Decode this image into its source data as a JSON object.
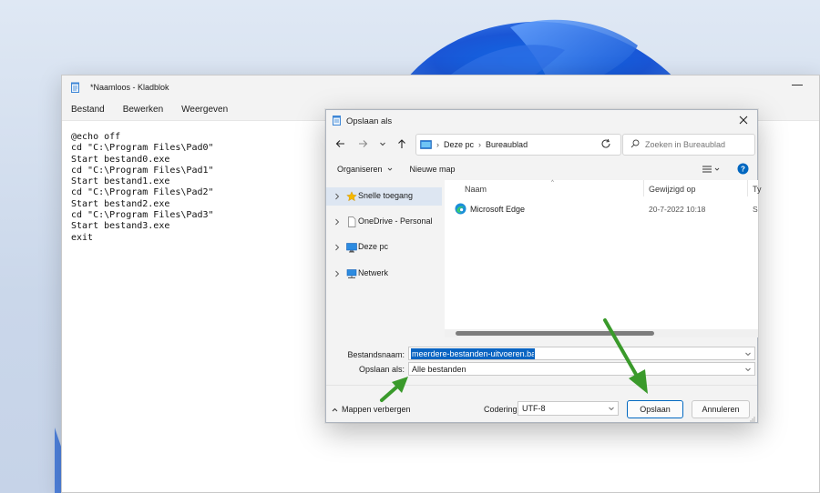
{
  "notepad": {
    "title": "*Naamloos - Kladblok",
    "menu": [
      "Bestand",
      "Bewerken",
      "Weergeven"
    ],
    "content": "@echo off\ncd \"C:\\Program Files\\Pad0\"\nStart bestand0.exe\ncd \"C:\\Program Files\\Pad1\"\nStart bestand1.exe\ncd \"C:\\Program Files\\Pad2\"\nStart bestand2.exe\ncd \"C:\\Program Files\\Pad3\"\nStart bestand3.exe\nexit"
  },
  "dialog": {
    "title": "Opslaan als",
    "address": {
      "segments": [
        "Deze pc",
        "Bureaublad"
      ]
    },
    "search": {
      "placeholder": "Zoeken in Bureaublad"
    },
    "toolbar": {
      "organize": "Organiseren",
      "new_folder": "Nieuwe map"
    },
    "sidebar": [
      {
        "label": "Snelle toegang",
        "icon": "star-icon",
        "selected": true
      },
      {
        "label": "OneDrive - Personal",
        "icon": "document-icon",
        "selected": false
      },
      {
        "label": "Deze pc",
        "icon": "monitor-icon",
        "selected": false
      },
      {
        "label": "Netwerk",
        "icon": "network-icon",
        "selected": false
      }
    ],
    "columns": [
      "Naam",
      "Gewijzigd op",
      "Ty"
    ],
    "files": [
      {
        "name": "Microsoft Edge",
        "modified": "20-7-2022 10:18",
        "type": "S",
        "icon": "edge-icon"
      }
    ],
    "filename_label": "Bestandsnaam:",
    "filename_value": "meerdere-bestanden-uitvoeren.bat",
    "savetype_label": "Opslaan als:",
    "savetype_value": "Alle bestanden",
    "hide_folders": "Mappen verbergen",
    "encoding_label": "Codering:",
    "encoding_value": "UTF-8",
    "save_button": "Opslaan",
    "cancel_button": "Annuleren"
  },
  "colors": {
    "accent": "#0067c0",
    "selection": "#0a64c2",
    "annotation_arrow": "#3a9a2b",
    "sidebar_selected": "#dde6f2"
  }
}
